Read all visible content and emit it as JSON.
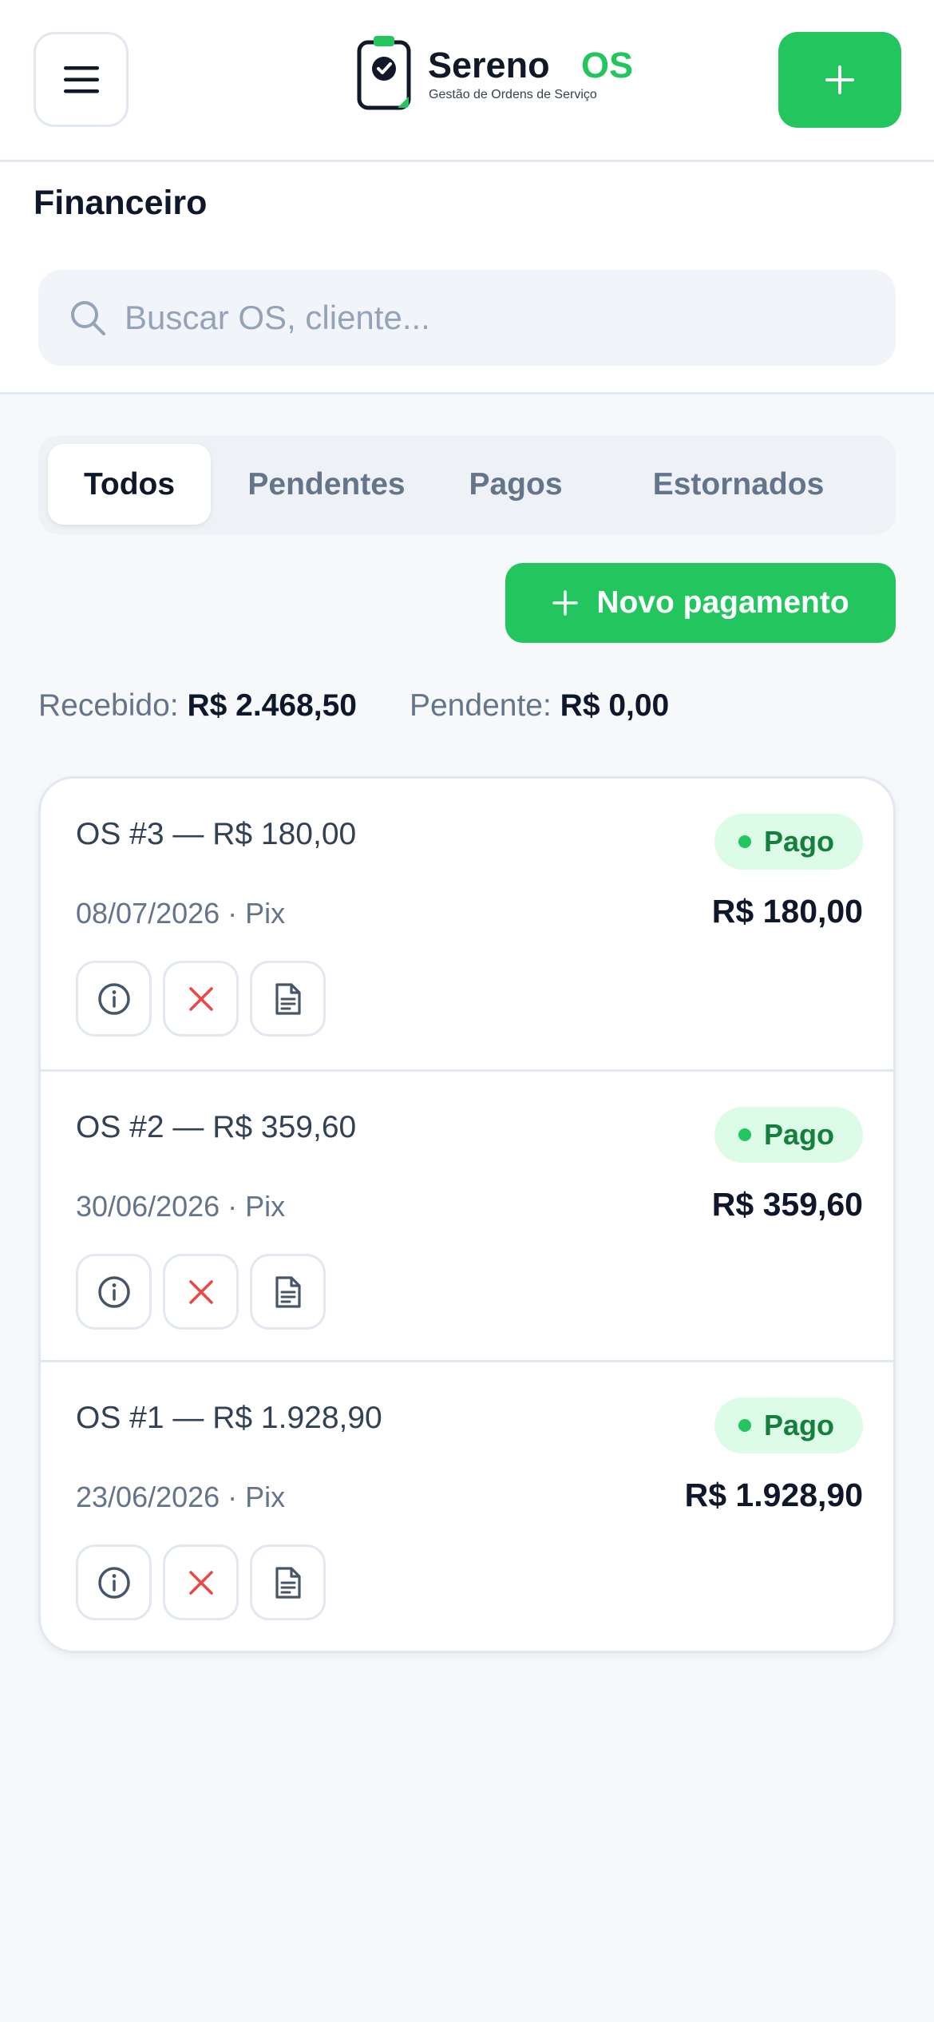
{
  "header": {
    "brand_name": "Sereno",
    "brand_suffix": "OS",
    "brand_tagline": "Gestão de Ordens de Serviço",
    "menu_icon": "hamburger-icon",
    "add_icon": "plus-icon"
  },
  "page": {
    "title": "Financeiro",
    "search_placeholder": "Buscar OS, cliente..."
  },
  "tabs": [
    {
      "label": "Todos",
      "active": true
    },
    {
      "label": "Pendentes",
      "active": false
    },
    {
      "label": "Pagos",
      "active": false
    },
    {
      "label": "Estornados",
      "active": false
    }
  ],
  "new_payment_label": "Novo pagamento",
  "totals": {
    "received_label": "Recebido:",
    "received_value": "R$ 2.468,50",
    "pending_label": "Pendente:",
    "pending_value": "R$ 0,00"
  },
  "payments": [
    {
      "title": "OS #3 — R$ 180,00",
      "meta": "08/07/2026 · Pix",
      "status": "Pago",
      "amount": "R$ 180,00"
    },
    {
      "title": "OS #2 — R$ 359,60",
      "meta": "30/06/2026 · Pix",
      "status": "Pago",
      "amount": "R$ 359,60"
    },
    {
      "title": "OS #1 — R$ 1.928,90",
      "meta": "23/06/2026 · Pix",
      "status": "Pago",
      "amount": "R$ 1.928,90"
    }
  ],
  "colors": {
    "accent": "#22c55e",
    "status_paid_bg": "#dcfce7",
    "status_paid_text": "#15803d",
    "danger": "#ef4444"
  }
}
